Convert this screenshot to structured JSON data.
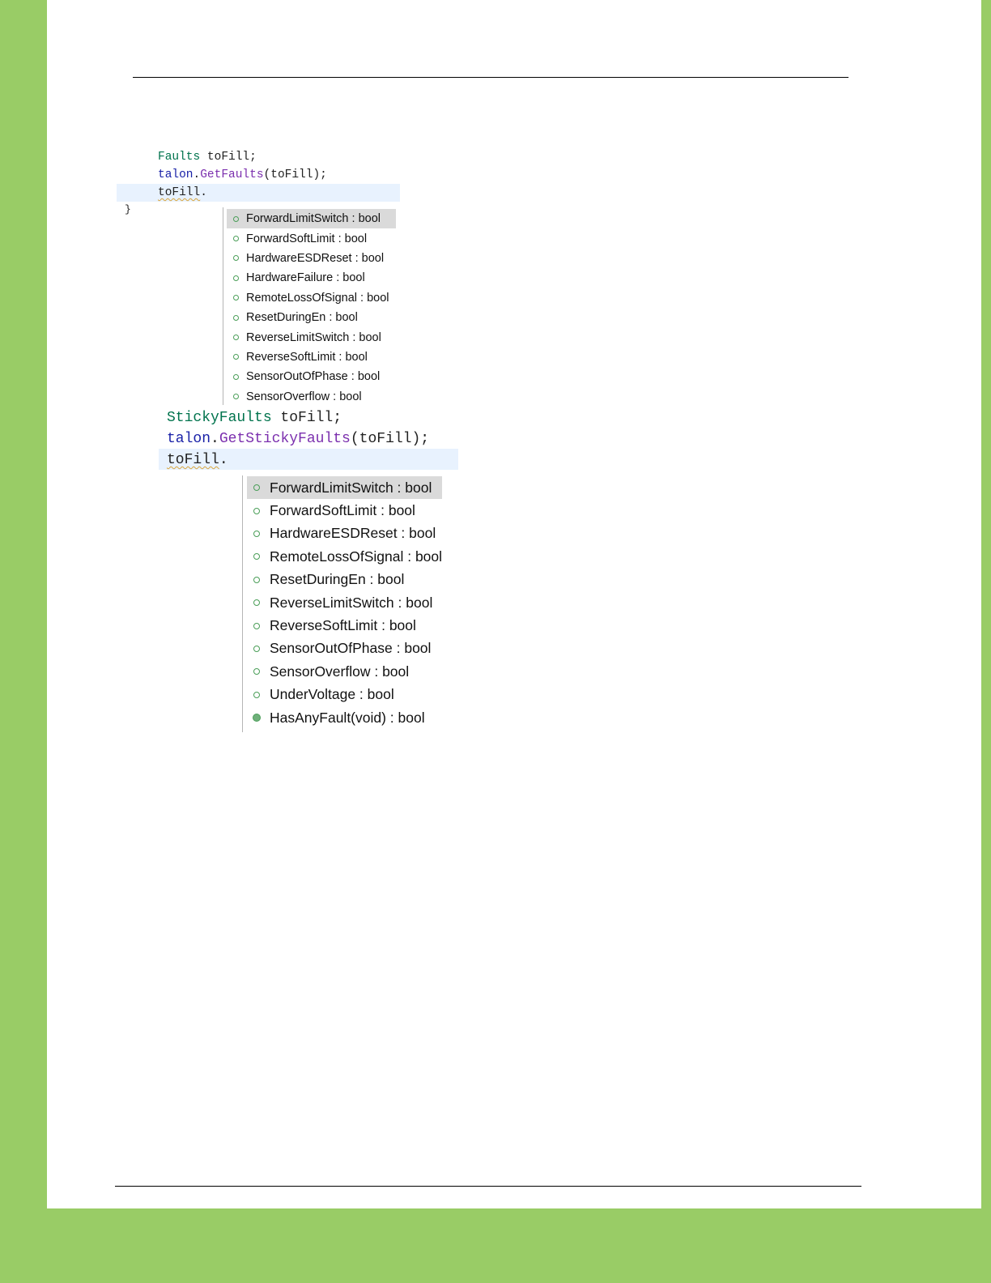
{
  "screenshot1": {
    "code_lines": {
      "line1_type": "Faults",
      "line1_rest": " toFill;",
      "line2_obj": "talon",
      "line2_dot": ".",
      "line2_method": "GetFaults",
      "line2_rest": "(toFill);",
      "line3_var": "toFill",
      "line3_dot": ".",
      "closing_brace": "}"
    },
    "completion_items": [
      "ForwardLimitSwitch : bool",
      "ForwardSoftLimit : bool",
      "HardwareESDReset : bool",
      "HardwareFailure : bool",
      "RemoteLossOfSignal : bool",
      "ResetDuringEn : bool",
      "ReverseLimitSwitch : bool",
      "ReverseSoftLimit : bool",
      "SensorOutOfPhase : bool",
      "SensorOverflow : bool"
    ]
  },
  "screenshot2": {
    "code_lines": {
      "line1_type": "StickyFaults",
      "line1_rest": " toFill;",
      "line2_obj": "talon",
      "line2_dot": ".",
      "line2_method": "GetStickyFaults",
      "line2_rest": "(toFill);",
      "line3_var": "toFill",
      "line3_dot": "."
    },
    "completion_items": [
      "ForwardLimitSwitch : bool",
      "ForwardSoftLimit : bool",
      "HardwareESDReset : bool",
      "RemoteLossOfSignal : bool",
      "ResetDuringEn : bool",
      "ReverseLimitSwitch : bool",
      "ReverseSoftLimit : bool",
      "SensorOutOfPhase : bool",
      "SensorOverflow : bool",
      "UnderVoltage : bool",
      "HasAnyFault(void) : bool"
    ]
  },
  "colors": {
    "page_border": "#99cc66",
    "type_color": "#00734d",
    "object_color": "#1a22a8",
    "method_color": "#7b2fae",
    "current_line": "#e8f2fe",
    "selection": "#dadada",
    "field_icon": "#4a9e58"
  },
  "icons": {
    "field": "hollow-green-circle-icon",
    "method": "filled-green-circle-icon"
  }
}
